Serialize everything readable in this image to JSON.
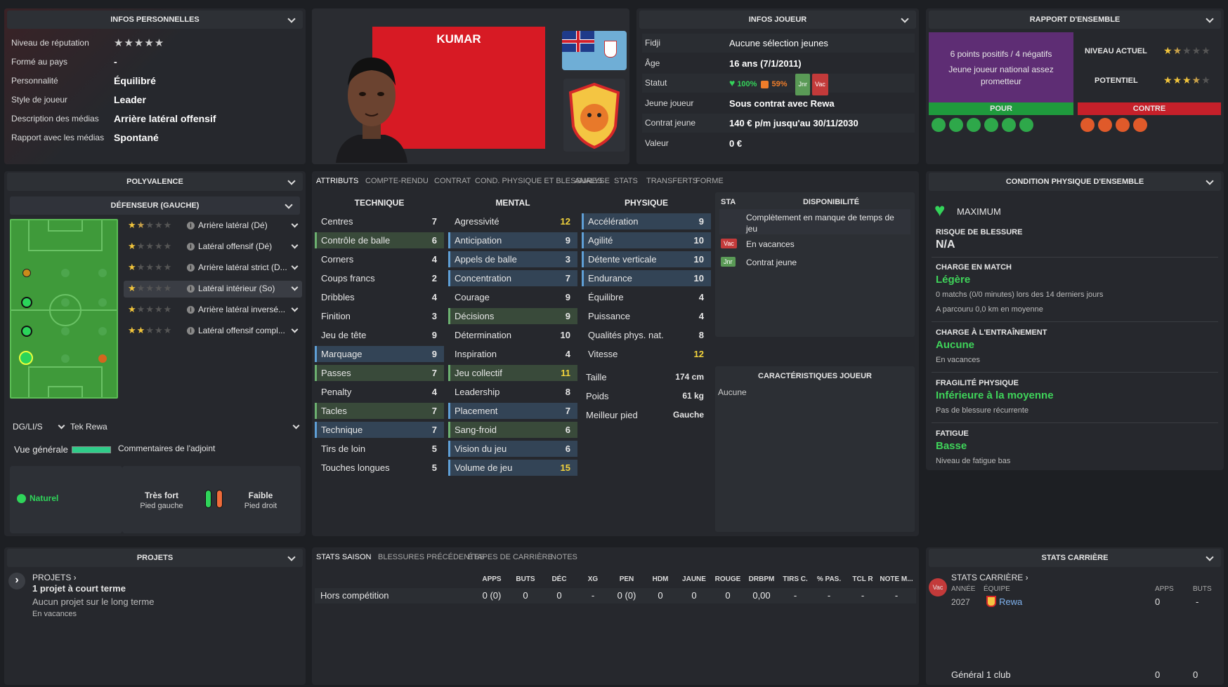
{
  "personal": {
    "title": "INFOS PERSONNELLES",
    "rows": [
      {
        "label": "Niveau de réputation",
        "value": "★★★★★"
      },
      {
        "label": "Formé au pays",
        "value": "-"
      },
      {
        "label": "Personnalité",
        "value": "Équilibré"
      },
      {
        "label": "Style de joueur",
        "value": "Leader"
      },
      {
        "label": "Description des médias",
        "value": "Arrière latéral offensif"
      },
      {
        "label": "Rapport avec les médias",
        "value": "Spontané"
      }
    ]
  },
  "versatility": {
    "title": "POLYVALENCE",
    "position_header": "DÉFENSEUR (GAUCHE)",
    "roles": [
      {
        "stars": "★★★★★",
        "label": "Arrière latéral (Dé)"
      },
      {
        "stars": "★★★★★",
        "label": "Latéral offensif (Dé)"
      },
      {
        "stars": "★★★★★",
        "label": "Arrière latéral strict (D..."
      },
      {
        "stars": "★★★★★",
        "label": "Latéral intérieur (So)"
      },
      {
        "stars": "★★★★★",
        "label": "Arrière latéral inversé..."
      },
      {
        "stars": "★★★★★",
        "label": "Latéral offensif compl..."
      }
    ],
    "formation": "DG/LI/S",
    "club": "Tek Rewa",
    "overview_label": "Vue générale",
    "assistant": "Commentaires de l'adjoint",
    "natural": "Naturel",
    "left_foot_grade": "Très fort",
    "left_foot": "Pied gauche",
    "right_foot_grade": "Faible",
    "right_foot": "Pied droit"
  },
  "player": {
    "name": "KUMAR"
  },
  "info": {
    "title": "INFOS JOUEUR",
    "rows": [
      {
        "label": "Fidji",
        "value": "Aucune sélection jeunes"
      },
      {
        "label": "Âge",
        "value": "16 ans (7/1/2011)"
      },
      {
        "label": "Statut",
        "value": ""
      },
      {
        "label": "Jeune joueur",
        "value": "Sous contrat avec Rewa"
      },
      {
        "label": "Contrat jeune",
        "value": "140 € p/m jusqu'au 30/11/2030"
      },
      {
        "label": "Valeur",
        "value": "0 €"
      }
    ],
    "status_fit": "100%",
    "status_sharp": "59%",
    "badge_jnr": "Jnr",
    "badge_vac": "Vac"
  },
  "report": {
    "title": "RAPPORT D'ENSEMBLE",
    "summary": "6 points positifs / 4 négatifs",
    "desc": "Jeune joueur national assez prometteur",
    "current_label": "NIVEAU ACTUEL",
    "potential_label": "POTENTIEL",
    "pros": "POUR",
    "cons": "CONTRE"
  },
  "tabs": [
    "ATTRIBUTS",
    "COMPTE-RENDU",
    "CONTRAT",
    "COND. PHYSIQUE ET BLESSURES",
    "ANALYSE",
    "STATS",
    "TRANSFERTS",
    "FORME"
  ],
  "attributes": {
    "technical_title": "TECHNIQUE",
    "mental_title": "MENTAL",
    "physical_title": "PHYSIQUE",
    "technical": [
      [
        "Centres",
        "7"
      ],
      [
        "Contrôle de balle",
        "6"
      ],
      [
        "Corners",
        "4"
      ],
      [
        "Coups francs",
        "2"
      ],
      [
        "Dribbles",
        "4"
      ],
      [
        "Finition",
        "3"
      ],
      [
        "Jeu de tête",
        "9"
      ],
      [
        "Marquage",
        "9"
      ],
      [
        "Passes",
        "7"
      ],
      [
        "Penalty",
        "4"
      ],
      [
        "Tacles",
        "7"
      ],
      [
        "Technique",
        "7"
      ],
      [
        "Tirs de loin",
        "5"
      ],
      [
        "Touches longues",
        "5"
      ]
    ],
    "mental": [
      [
        "Agressivité",
        "12"
      ],
      [
        "Anticipation",
        "9"
      ],
      [
        "Appels de balle",
        "3"
      ],
      [
        "Concentration",
        "7"
      ],
      [
        "Courage",
        "9"
      ],
      [
        "Décisions",
        "9"
      ],
      [
        "Détermination",
        "10"
      ],
      [
        "Inspiration",
        "4"
      ],
      [
        "Jeu collectif",
        "11"
      ],
      [
        "Leadership",
        "8"
      ],
      [
        "Placement",
        "7"
      ],
      [
        "Sang-froid",
        "6"
      ],
      [
        "Vision du jeu",
        "6"
      ],
      [
        "Volume de jeu",
        "15"
      ]
    ],
    "physical": [
      [
        "Accélération",
        "9"
      ],
      [
        "Agilité",
        "10"
      ],
      [
        "Détente verticale",
        "10"
      ],
      [
        "Endurance",
        "10"
      ],
      [
        "Équilibre",
        "4"
      ],
      [
        "Puissance",
        "4"
      ],
      [
        "Qualités phys. nat.",
        "8"
      ],
      [
        "Vitesse",
        "12"
      ]
    ],
    "height_label": "Taille",
    "height": "174 cm",
    "weight_label": "Poids",
    "weight": "61 kg",
    "foot_label": "Meilleur pied",
    "foot": "Gauche"
  },
  "availability": {
    "sta": "STA",
    "title": "DISPONIBILITÉ",
    "items": [
      "Complètement en manque de temps de jeu",
      "En vacances",
      "Contrat jeune"
    ],
    "vac": "Vac",
    "jnr": "Jnr"
  },
  "traits": {
    "title": "CARACTÉRISTIQUES JOUEUR",
    "value": "Aucune"
  },
  "condition": {
    "title": "CONDITION PHYSIQUE D'ENSEMBLE",
    "max": "MAXIMUM",
    "injury_label": "RISQUE DE BLESSURE",
    "injury": "N/A",
    "match_label": "CHARGE EN MATCH",
    "match": "Légère",
    "match_sub1": "0 matchs (0/0 minutes) lors des 14 derniers jours",
    "match_sub2": "A parcouru 0,0 km en moyenne",
    "train_label": "CHARGE À L'ENTRAÎNEMENT",
    "train": "Aucune",
    "train_sub": "En vacances",
    "frag_label": "FRAGILITÉ PHYSIQUE",
    "frag": "Inférieure à la moyenne",
    "frag_sub": "Pas de blessure récurrente",
    "fat_label": "FATIGUE",
    "fat": "Basse",
    "fat_sub": "Niveau de fatigue bas"
  },
  "projects": {
    "title": "PROJETS",
    "link": "PROJETS",
    "main": "1 projet à court terme",
    "sub": "Aucun projet sur le long terme",
    "sub2": "En vacances"
  },
  "season": {
    "tabs": [
      "STATS SAISON",
      "BLESSURES PRÉCÉDENTES",
      "ÉTAPES DE CARRIÈRE",
      "NOTES"
    ],
    "headers": [
      "APPS",
      "BUTS",
      "DÉC",
      "XG",
      "PEN",
      "HDM",
      "JAUNE",
      "ROUGE",
      "DRBPM",
      "TIRS C.",
      "% PAS.",
      "TCL R",
      "NOTE M..."
    ],
    "row_label": "Hors compétition",
    "row": [
      "0 (0)",
      "0",
      "0",
      "-",
      "0 (0)",
      "0",
      "0",
      "0",
      "0,00",
      "-",
      "-",
      "-",
      "-"
    ]
  },
  "career": {
    "title": "STATS CARRIÈRE",
    "link": "STATS CARRIÈRE",
    "year_h": "ANNÉE",
    "team_h": "ÉQUIPE",
    "apps_h": "APPS",
    "goals_h": "BUTS",
    "year": "2027",
    "team": "Rewa",
    "apps": "0",
    "goals": "-",
    "total": "Général 1 club",
    "total_apps": "0",
    "total_goals": "0",
    "vac": "Vac"
  }
}
